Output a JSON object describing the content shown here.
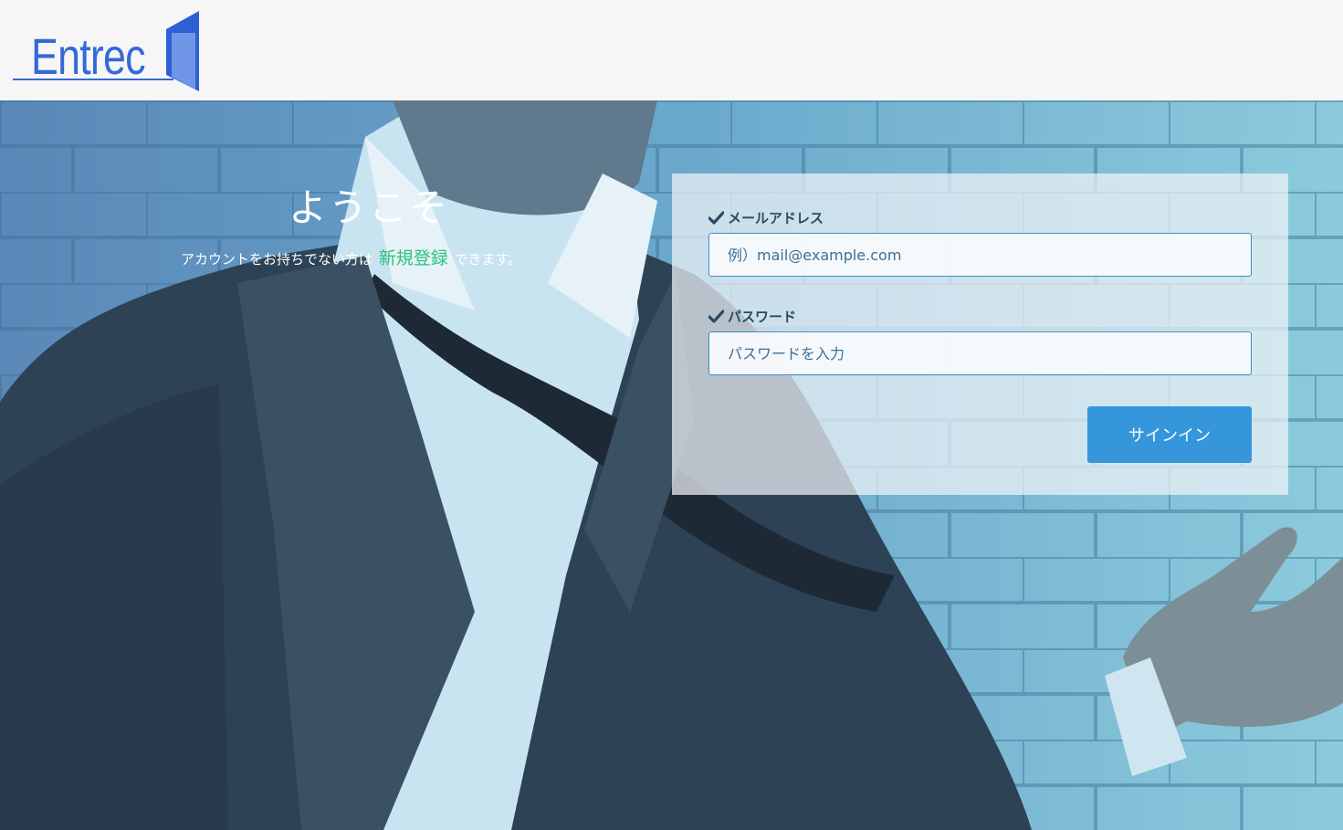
{
  "header": {
    "logo_text": "Entrec"
  },
  "welcome": {
    "title": "ようこそ",
    "text_before": "アカウントをお持ちでない方は",
    "signup_link": "新規登録",
    "text_after": "できます。"
  },
  "form": {
    "email_label": "メールアドレス",
    "email_placeholder": "例）mail@example.com",
    "password_label": "パスワード",
    "password_placeholder": "パスワードを入力",
    "submit_label": "サインイン"
  },
  "colors": {
    "brand": "#3568d8",
    "link": "#2cc27c",
    "button": "#3596dc",
    "header_bg": "#f6f6f6"
  },
  "icons": {
    "label_icon": "check-icon"
  }
}
